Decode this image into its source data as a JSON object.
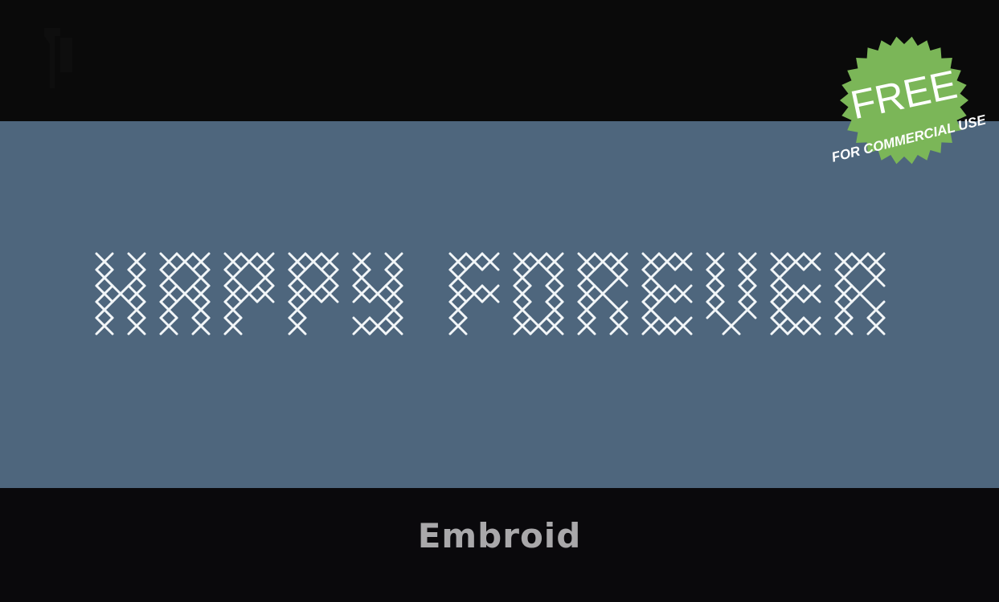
{
  "preview": {
    "sample_text": "HAPPY FOREVER",
    "background_color": "#4e667d",
    "text_color": "#f2f6f8"
  },
  "badge": {
    "title": "FREE",
    "subtitle": "FOR COMMERCIAL USE",
    "color": "#7bb658"
  },
  "font": {
    "name": "Embroid"
  },
  "glyphs": {
    "H": [
      "101",
      "101",
      "111",
      "101",
      "101"
    ],
    "A": [
      "111",
      "101",
      "111",
      "101",
      "101"
    ],
    "P": [
      "111",
      "101",
      "111",
      "100",
      "100"
    ],
    "Y": [
      "101",
      "101",
      "111",
      "001",
      "111"
    ],
    "F": [
      "111",
      "100",
      "111",
      "100",
      "100"
    ],
    "O": [
      "111",
      "101",
      "101",
      "101",
      "111"
    ],
    "R": [
      "111",
      "101",
      "110",
      "101",
      "101"
    ],
    "E": [
      "111",
      "100",
      "111",
      "100",
      "111"
    ],
    "V": [
      "101",
      "101",
      "101",
      "101",
      "010"
    ]
  }
}
